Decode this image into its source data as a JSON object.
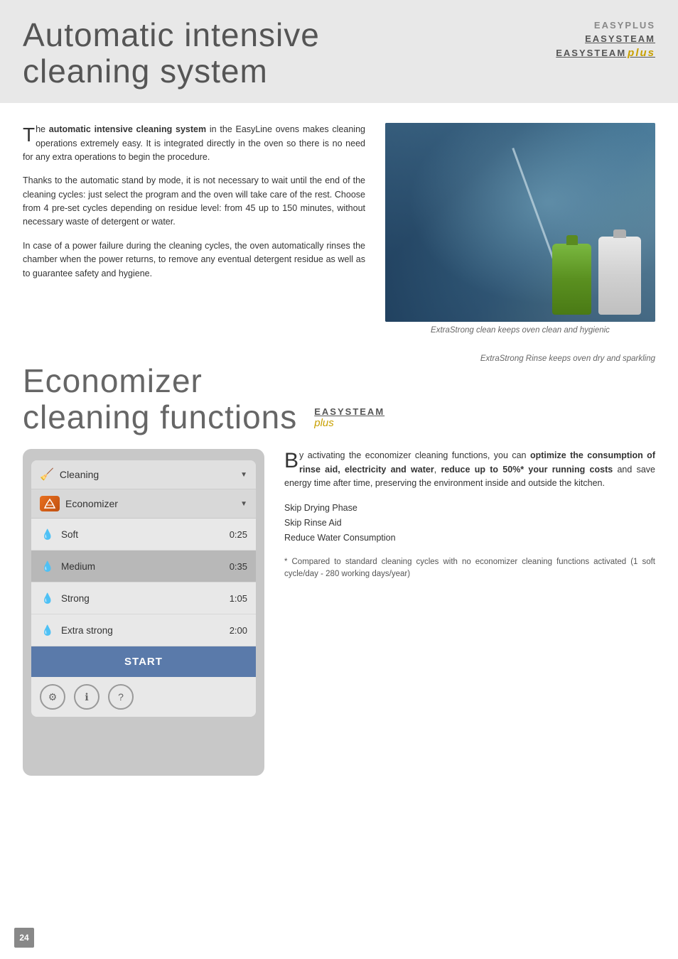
{
  "header": {
    "title_line1": "Automatic intensive",
    "title_line2": "cleaning system",
    "brand1": "EASYPLUS",
    "brand2": "EASYSTEAM",
    "brand3": "EASYSTEAM",
    "brand3_suffix": "plus"
  },
  "section1": {
    "paragraph1_dropcap": "T",
    "paragraph1_bold": "automatic intensive cleaning system",
    "paragraph1_rest": " in the EasyLine ovens makes cleaning operations extremely easy. It is integrated directly in the oven so there is no need for any extra operations to begin the procedure.",
    "paragraph2": "Thanks to the automatic stand by mode, it is not necessary to wait until the end of the cleaning cycles: just select the program and the oven will take care of the rest. Choose from 4 pre-set cycles depending on residue level: from 45 up to 150 minutes, without necessary waste of detergent or water.",
    "paragraph3": "In case of a power failure during the cleaning cycles, the oven automatically rinses the chamber when the power returns, to remove any eventual detergent residue as well as to guarantee safety and hygiene.",
    "caption1": "ExtraStrong clean keeps oven clean and hygienic"
  },
  "section2": {
    "caption_top": "ExtraStrong Rinse keeps oven dry and sparkling",
    "title_line1": "Economizer",
    "title_line2": "cleaning functions",
    "brand": "EASYSTEAM",
    "brand_suffix": "plus",
    "panel": {
      "header_label": "Cleaning",
      "submenu_label": "Economizer",
      "rows": [
        {
          "label": "Soft",
          "time": "0:25",
          "medium": false
        },
        {
          "label": "Medium",
          "time": "0:35",
          "medium": true
        },
        {
          "label": "Strong",
          "time": "1:05",
          "medium": false
        },
        {
          "label": "Extra strong",
          "time": "2:00",
          "medium": false
        }
      ],
      "start_label": "START"
    },
    "drop_cap": "B",
    "intro_text": "y activating the economizer cleaning functions, you can ",
    "bold_text": "optimize the consumption of rinse aid, electricity and water",
    "mid_text": ", ",
    "bold_text2": "reduce up to 50%* your running costs",
    "rest_text": " and save energy time after time, preserving the environment inside and outside the kitchen.",
    "skip_items": [
      "Skip Drying Phase",
      "Skip Rinse Aid",
      "Reduce Water Consumption"
    ],
    "footnote": "* Compared to standard cleaning cycles with no economizer cleaning functions activated (1 soft cycle/day - 280 working days/year)"
  },
  "page_number": "24"
}
